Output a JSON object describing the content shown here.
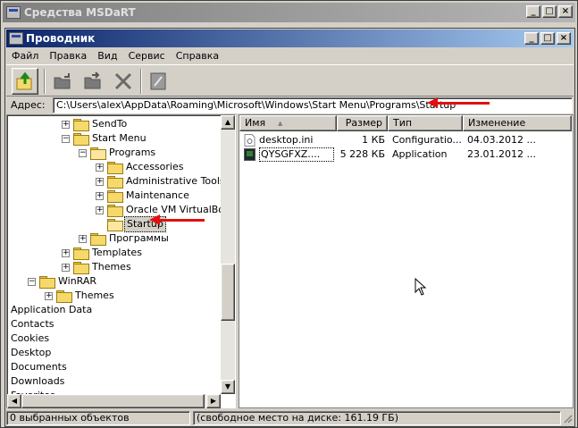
{
  "outer_window": {
    "title": "Средства MSDaRT",
    "buttons": [
      "_",
      "□",
      "×"
    ]
  },
  "window": {
    "title": "Проводник",
    "buttons": [
      "_",
      "□",
      "×"
    ]
  },
  "menu": [
    "Файл",
    "Правка",
    "Вид",
    "Сервис",
    "Справка"
  ],
  "toolbar": {
    "icons": [
      "up-folder-icon",
      "copy-to-icon",
      "move-to-icon",
      "delete-icon",
      "properties-icon"
    ]
  },
  "address": {
    "label": "Адрес:",
    "value": "C:\\Users\\alex\\AppData\\Roaming\\Microsoft\\Windows\\Start Menu\\Programs\\Startup"
  },
  "tree": [
    {
      "label": "SendTo",
      "indent": 3,
      "expander": "+",
      "icon": "folder"
    },
    {
      "label": "Start Menu",
      "indent": 3,
      "expander": "-",
      "icon": "folder"
    },
    {
      "label": "Programs",
      "indent": 4,
      "expander": "-",
      "icon": "folder-open"
    },
    {
      "label": "Accessories",
      "indent": 5,
      "expander": "+",
      "icon": "folder"
    },
    {
      "label": "Administrative Tools",
      "indent": 5,
      "expander": "+",
      "icon": "folder"
    },
    {
      "label": "Maintenance",
      "indent": 5,
      "expander": "+",
      "icon": "folder"
    },
    {
      "label": "Oracle VM VirtualBox Gue",
      "indent": 5,
      "expander": "+",
      "icon": "folder"
    },
    {
      "label": "Startup",
      "indent": 5,
      "expander": "",
      "icon": "folder-open",
      "selected": true
    },
    {
      "label": "Программы",
      "indent": 4,
      "expander": "+",
      "icon": "folder"
    },
    {
      "label": "Templates",
      "indent": 3,
      "expander": "+",
      "icon": "folder"
    },
    {
      "label": "Themes",
      "indent": 3,
      "expander": "+",
      "icon": "folder"
    },
    {
      "label": "WinRAR",
      "indent": 1,
      "expander": "-",
      "icon": "folder"
    },
    {
      "label": "Themes",
      "indent": 2,
      "expander": "+",
      "icon": "folder"
    },
    {
      "label": "Application Data",
      "indent": 0,
      "expander": "",
      "icon": ""
    },
    {
      "label": "Contacts",
      "indent": 0,
      "expander": "",
      "icon": ""
    },
    {
      "label": "Cookies",
      "indent": 0,
      "expander": "",
      "icon": ""
    },
    {
      "label": "Desktop",
      "indent": 0,
      "expander": "",
      "icon": ""
    },
    {
      "label": "Documents",
      "indent": 0,
      "expander": "",
      "icon": ""
    },
    {
      "label": "Downloads",
      "indent": 0,
      "expander": "",
      "icon": ""
    },
    {
      "label": "Favorites",
      "indent": 0,
      "expander": "",
      "icon": ""
    }
  ],
  "list": {
    "columns": [
      "Имя",
      "Размер",
      "Тип",
      "Изменение"
    ],
    "sort_indicator": "▲",
    "rows": [
      {
        "name": "desktop.ini",
        "size": "1 КБ",
        "type": "Configuratio...",
        "modified": "04.03.2012 ...",
        "icon": "settings-file-icon"
      },
      {
        "name": "QYSGFXZ....",
        "size": "5 228 КБ",
        "type": "Application",
        "modified": "23.01.2012 ...",
        "icon": "application-icon",
        "focused": true
      }
    ]
  },
  "status": {
    "selected": "0 выбранных объектов",
    "free": "(свободное место на диске: 161.19 ГБ)"
  },
  "colors": {
    "titlebar_active": "#0a246a",
    "titlebar_inactive": "#808080",
    "annotation_arrow": "#e01010"
  }
}
